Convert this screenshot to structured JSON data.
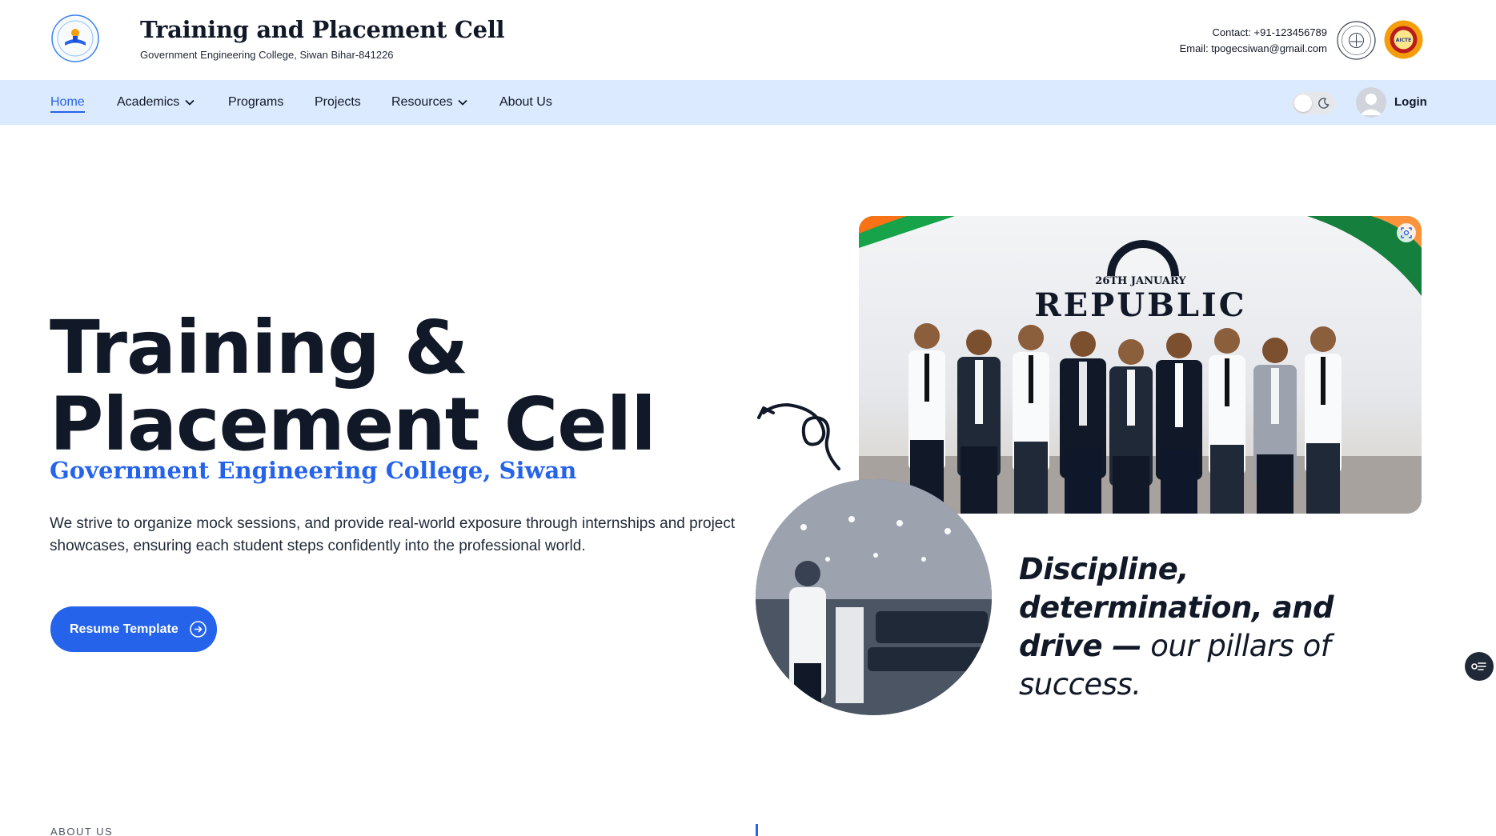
{
  "header": {
    "title": "Training and Placement Cell",
    "subtitle": "Government Engineering College, Siwan Bihar-841226",
    "contact_phone": "Contact: +91-123456789",
    "contact_email": "Email: tpogecsiwan@gmail.com",
    "aicte_badge_text": "AICTE"
  },
  "nav": {
    "items": [
      {
        "label": "Home",
        "active": true
      },
      {
        "label": "Academics",
        "dropdown": true
      },
      {
        "label": "Programs"
      },
      {
        "label": "Projects"
      },
      {
        "label": "Resources",
        "dropdown": true
      },
      {
        "label": "About Us"
      }
    ],
    "login_label": "Login"
  },
  "hero": {
    "title_line1": "Training &",
    "title_line2": "Placement Cell",
    "college": "Government Engineering College, Siwan",
    "description": "We strive to organize mock sessions, and provide real-world exposure through internships and project showcases, ensuring each student steps confidently into the professional world.",
    "cta_label": "Resume Template",
    "photo_banner_date": "26TH JANUARY",
    "photo_banner_title": "REPUBLIC",
    "motto_bold": "Discipline, determination, and drive —",
    "motto_rest": " our pillars of success."
  },
  "about": {
    "label": "ABOUT US"
  },
  "colors": {
    "accent": "#2563eb",
    "nav_bg": "#dbeafe",
    "text_dark": "#111827"
  }
}
